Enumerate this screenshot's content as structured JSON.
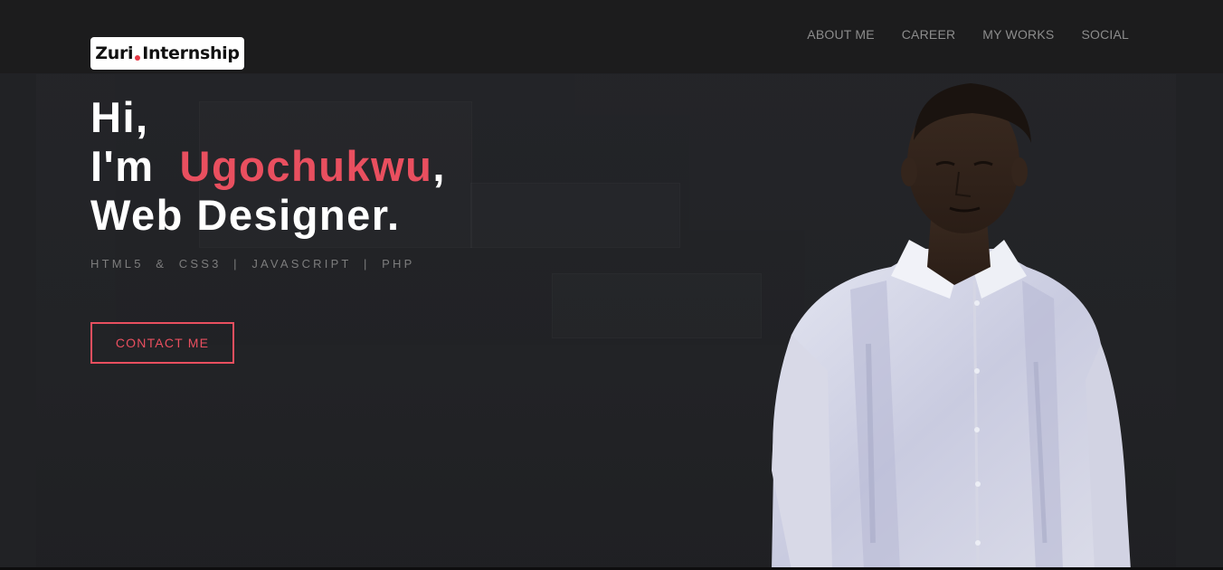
{
  "logo": {
    "part1": "Zuri",
    "part2": "Internship"
  },
  "nav": {
    "items": [
      {
        "label": "ABOUT ME"
      },
      {
        "label": "CAREER"
      },
      {
        "label": "MY WORKS"
      },
      {
        "label": "SOCIAL"
      }
    ]
  },
  "hero": {
    "line1": "Hi,",
    "line2_prefix": "I'm",
    "name": "Ugochukwu",
    "line2_suffix": ",",
    "line3": "Web Designer.",
    "skills": "HTML5  &  CSS3  |  JAVASCRIPT  |  PHP",
    "cta_label": "CONTACT ME"
  },
  "colors": {
    "accent": "#e94f5f",
    "background": "#212225",
    "topbar": "#1c1c1d",
    "nav_text": "#8c8c8c"
  },
  "image": {
    "icon": "portrait-photo"
  }
}
